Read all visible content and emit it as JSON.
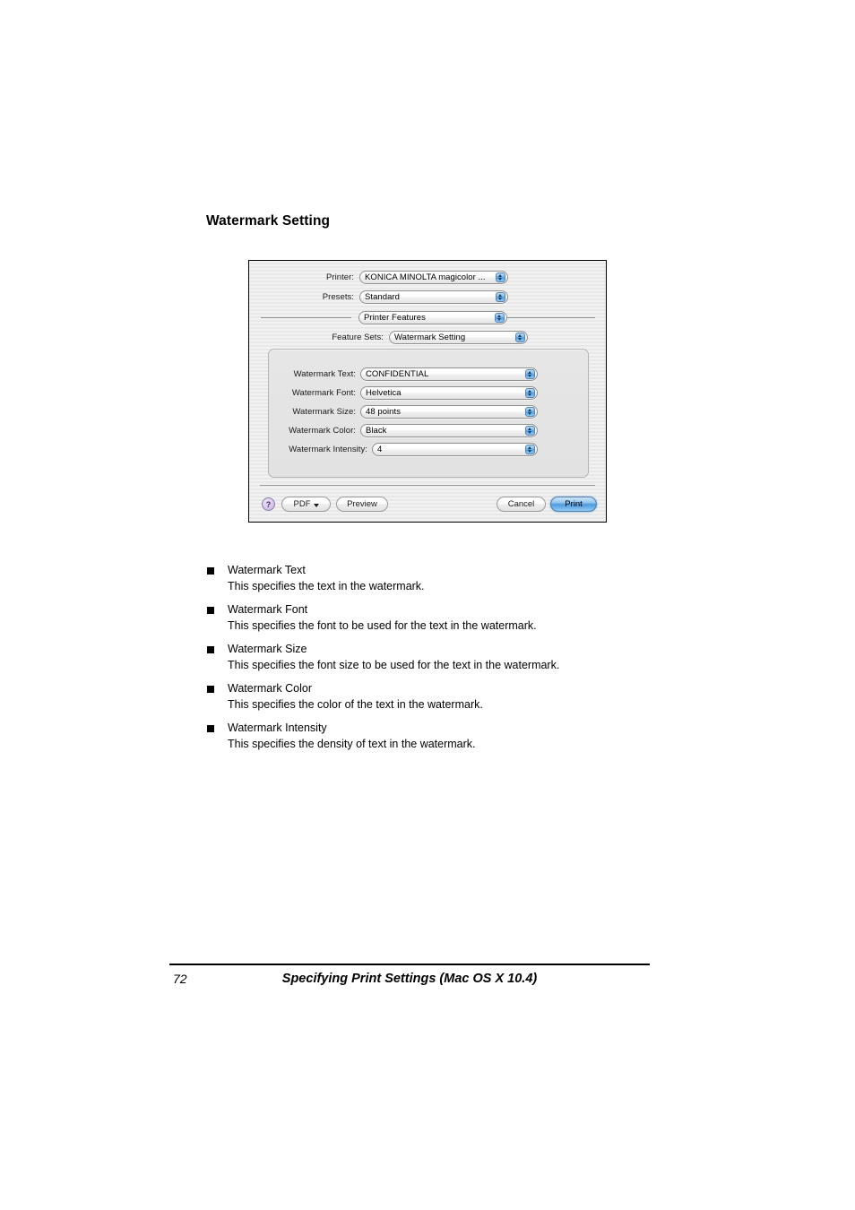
{
  "page": {
    "heading": "Watermark Setting",
    "number": "72",
    "footer_title": "Specifying Print Settings (Mac OS X 10.4)"
  },
  "dialog": {
    "printer": {
      "label": "Printer:",
      "value": "KONICA MINOLTA magicolor ..."
    },
    "presets": {
      "label": "Presets:",
      "value": "Standard"
    },
    "pane": {
      "value": "Printer Features"
    },
    "feature_sets": {
      "label": "Feature Sets:",
      "value": "Watermark Setting"
    },
    "options": [
      {
        "label": "Watermark Text:",
        "value": "CONFIDENTIAL"
      },
      {
        "label": "Watermark Font:",
        "value": "Helvetica"
      },
      {
        "label": "Watermark Size:",
        "value": "48 points"
      },
      {
        "label": "Watermark Color:",
        "value": "Black"
      },
      {
        "label": "Watermark Intensity:",
        "value": "4"
      }
    ],
    "buttons": {
      "help": "?",
      "pdf": "PDF",
      "preview": "Preview",
      "cancel": "Cancel",
      "print": "Print"
    }
  },
  "descriptions": [
    {
      "term": "Watermark Text",
      "desc": "This specifies the text in the watermark."
    },
    {
      "term": "Watermark Font",
      "desc": "This specifies the font to be used for the text in the watermark."
    },
    {
      "term": "Watermark Size",
      "desc": "This specifies the font size to be used for the text in the watermark."
    },
    {
      "term": "Watermark Color",
      "desc": "This specifies the color of the text in the watermark."
    },
    {
      "term": "Watermark Intensity",
      "desc": "This specifies the density of text in the watermark."
    }
  ],
  "colors": {
    "accent": "#4d9ade",
    "dialog_bg": "#eeeeee",
    "help_button": "#b9a4dc"
  }
}
